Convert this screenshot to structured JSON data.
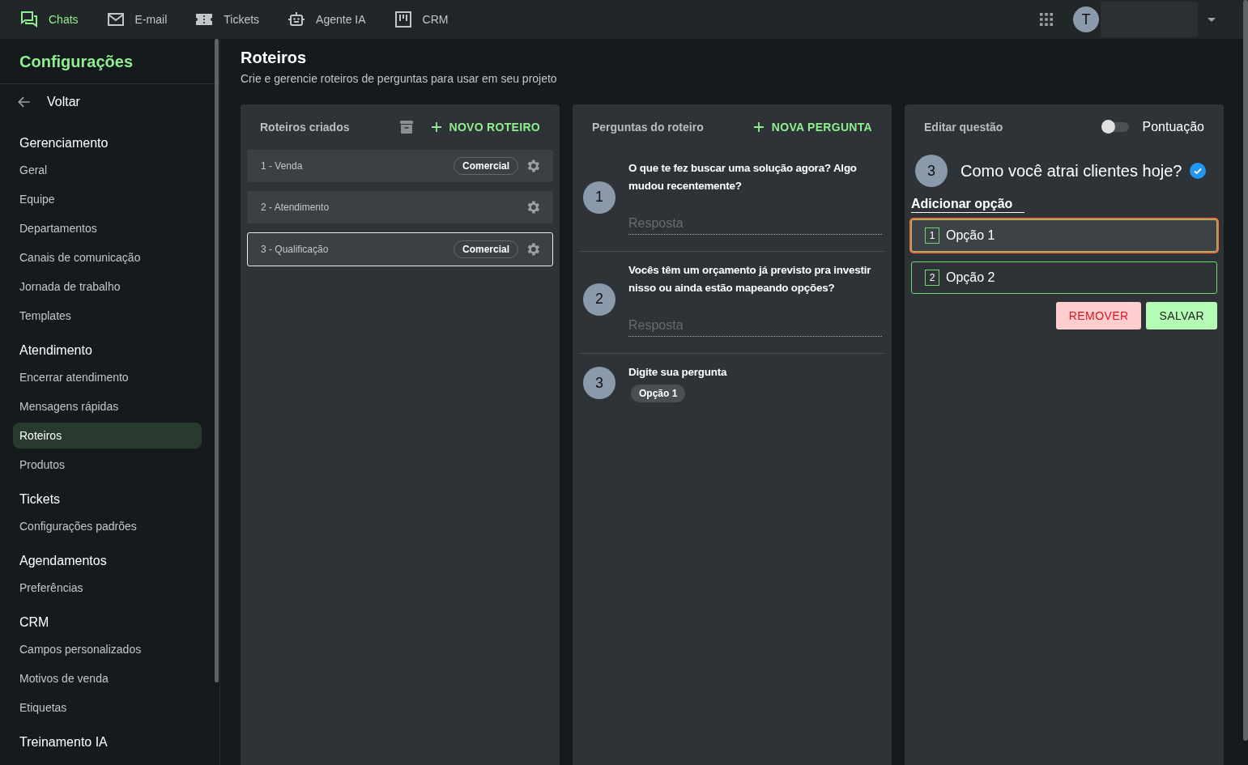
{
  "topbar": {
    "tabs": [
      {
        "label": "Chats",
        "kind": "chat",
        "selected": true
      },
      {
        "label": "E-mail",
        "kind": "mail",
        "selected": false
      },
      {
        "label": "Tickets",
        "kind": "ticket",
        "selected": false
      },
      {
        "label": "Agente IA",
        "kind": "robot",
        "selected": false
      },
      {
        "label": "CRM",
        "kind": "board",
        "selected": false
      }
    ],
    "avatar": "T"
  },
  "sidebar": {
    "title": "Configurações",
    "back": "Voltar",
    "sections": [
      {
        "title": "Gerenciamento",
        "items": [
          {
            "label": "Geral",
            "selected": false
          },
          {
            "label": "Equipe",
            "selected": false
          },
          {
            "label": "Departamentos",
            "selected": false
          },
          {
            "label": "Canais de comunicação",
            "selected": false
          },
          {
            "label": "Jornada de trabalho",
            "selected": false
          },
          {
            "label": "Templates",
            "selected": false
          }
        ]
      },
      {
        "title": "Atendimento",
        "items": [
          {
            "label": "Encerrar atendimento",
            "selected": false
          },
          {
            "label": "Mensagens rápidas",
            "selected": false
          },
          {
            "label": "Roteiros",
            "selected": true
          },
          {
            "label": "Produtos",
            "selected": false
          }
        ]
      },
      {
        "title": "Tickets",
        "items": [
          {
            "label": "Configurações padrões",
            "selected": false
          }
        ]
      },
      {
        "title": "Agendamentos",
        "items": [
          {
            "label": "Preferências",
            "selected": false
          }
        ]
      },
      {
        "title": "CRM",
        "items": [
          {
            "label": "Campos personalizados",
            "selected": false
          },
          {
            "label": "Motivos de venda",
            "selected": false
          },
          {
            "label": "Etiquetas",
            "selected": false
          }
        ]
      },
      {
        "title": "Treinamento IA"
      }
    ]
  },
  "page": {
    "title": "Roteiros",
    "subtitle": "Crie e gerencie roteiros de perguntas para usar em seu projeto"
  },
  "scripts": {
    "title": "Roteiros criados",
    "add_button": "NOVO ROTEIRO",
    "items": [
      {
        "label": "1 - Venda",
        "tag": "Comercial",
        "selected": false
      },
      {
        "label": "2 - Atendimento",
        "selected": false
      },
      {
        "label": "3 - Qualificação",
        "tag": "Comercial",
        "selected": true
      }
    ]
  },
  "questions": {
    "title": "Perguntas do roteiro",
    "add_button": "NOVA PERGUNTA",
    "items": [
      {
        "number": "1",
        "text": "O que te fez buscar uma solução agora? Algo mudou recentemente?",
        "placeholder": "Resposta"
      },
      {
        "number": "2",
        "text": "Vocês têm um orçamento já previsto pra investir nisso ou ainda estão mapeando opções?",
        "placeholder": "Resposta"
      },
      {
        "number": "3",
        "text": "Digite sua pergunta",
        "options": [
          "Opção 1"
        ]
      }
    ]
  },
  "editor": {
    "title": "Editar questão",
    "toggle": {
      "label": "Pontuação",
      "on": false
    },
    "question": {
      "number": "3",
      "text": "Como você atrai clientes hoje?",
      "checked": true
    },
    "add_option": "Adicionar opção",
    "options": [
      {
        "number": "1",
        "label": "Opção 1",
        "focused": true
      },
      {
        "number": "2",
        "label": "Opção 2",
        "focused": false
      }
    ],
    "remove_button": "REMOVER",
    "save_button": "SALVAR"
  }
}
